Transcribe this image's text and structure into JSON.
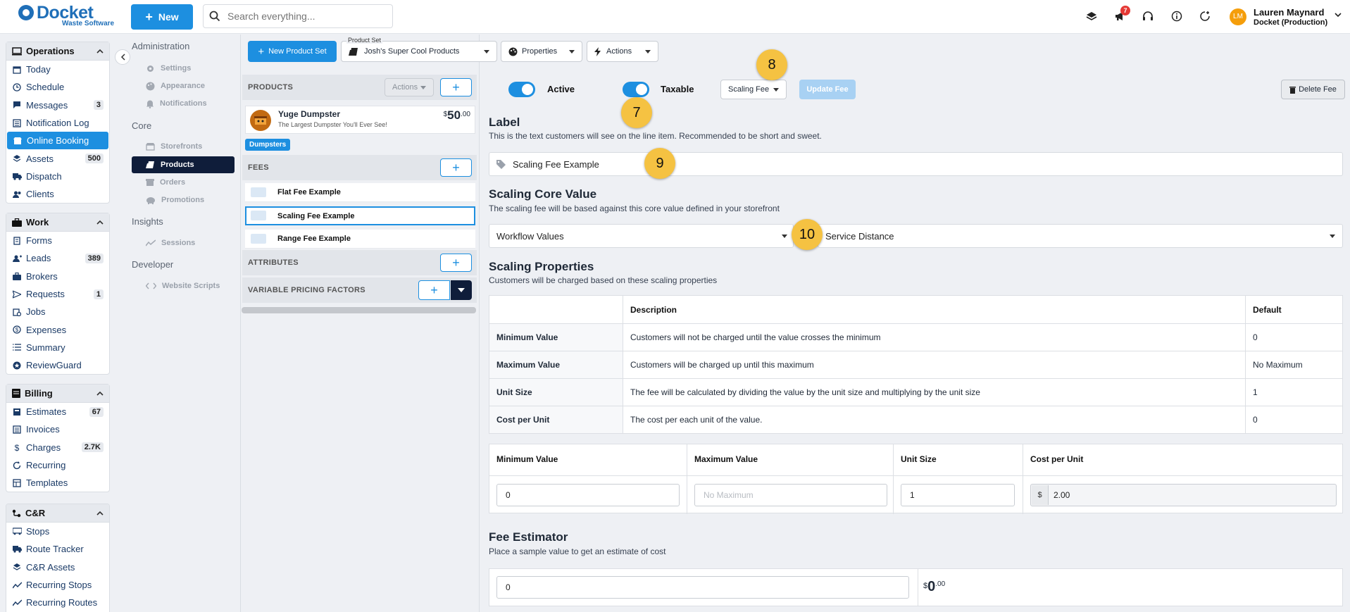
{
  "brand": {
    "name": "Docket",
    "sub": "Waste Software"
  },
  "topbar": {
    "new_label": "New",
    "search_placeholder": "Search everything...",
    "notif_count": "7",
    "user_initials": "LM",
    "user_name": "Lauren Maynard",
    "user_org": "Docket (Production)"
  },
  "sidebar": {
    "operations": {
      "title": "Operations",
      "items": [
        {
          "label": "Today"
        },
        {
          "label": "Schedule"
        },
        {
          "label": "Messages",
          "count": "3"
        },
        {
          "label": "Notification Log"
        },
        {
          "label": "Online Booking"
        },
        {
          "label": "Assets",
          "count": "500"
        },
        {
          "label": "Dispatch"
        },
        {
          "label": "Clients"
        }
      ]
    },
    "work": {
      "title": "Work",
      "items": [
        {
          "label": "Forms"
        },
        {
          "label": "Leads",
          "count": "389"
        },
        {
          "label": "Brokers"
        },
        {
          "label": "Requests",
          "count": "1"
        },
        {
          "label": "Jobs"
        },
        {
          "label": "Expenses"
        },
        {
          "label": "Summary"
        },
        {
          "label": "ReviewGuard"
        }
      ]
    },
    "billing": {
      "title": "Billing",
      "items": [
        {
          "label": "Estimates",
          "count": "67"
        },
        {
          "label": "Invoices"
        },
        {
          "label": "Charges",
          "count": "2.7K"
        },
        {
          "label": "Recurring"
        },
        {
          "label": "Templates"
        }
      ]
    },
    "cr": {
      "title": "C&R",
      "items": [
        {
          "label": "Stops"
        },
        {
          "label": "Route Tracker"
        },
        {
          "label": "C&R Assets"
        },
        {
          "label": "Recurring Stops"
        },
        {
          "label": "Recurring Routes"
        }
      ]
    }
  },
  "subnav": {
    "administration": "Administration",
    "admin_items": [
      "Settings",
      "Appearance",
      "Notifications"
    ],
    "core": "Core",
    "core_items": [
      "Storefronts",
      "Products",
      "Orders",
      "Promotions"
    ],
    "insights": "Insights",
    "insights_items": [
      "Sessions"
    ],
    "developer": "Developer",
    "developer_items": [
      "Website Scripts"
    ]
  },
  "toolbar": {
    "new_product_set": "New Product Set",
    "product_set_label": "Product Set",
    "product_set_value": "Josh's Super Cool Products",
    "properties": "Properties",
    "actions": "Actions"
  },
  "products": {
    "section": "PRODUCTS",
    "actions": "Actions",
    "item": {
      "name": "Yuge Dumpster",
      "desc": "The Largest Dumpster You'll Ever See!",
      "currency": "$",
      "price": "50",
      "cents": ".00"
    },
    "tag": "Dumpsters",
    "fees_section": "FEES",
    "fees": [
      "Flat Fee Example",
      "Scaling Fee Example",
      "Range Fee Example"
    ],
    "attributes_section": "ATTRIBUTES",
    "vpf_section": "VARIABLE PRICING FACTORS"
  },
  "fee": {
    "active_label": "Active",
    "taxable_label": "Taxable",
    "type_value": "Scaling Fee",
    "update_label": "Update Fee",
    "delete_label": "Delete Fee",
    "label_title": "Label",
    "label_desc": "This is the text customers will see on the line item. Recommended to be short and sweet.",
    "label_value": "Scaling Fee Example",
    "core_title": "Scaling Core Value",
    "core_desc": "The scaling fee will be based against this core value defined in your storefront",
    "core_group": "Workflow Values",
    "core_value": "Service Distance",
    "props_title": "Scaling Properties",
    "props_desc": "Customers will be charged based on these scaling properties",
    "table": {
      "headers": [
        "",
        "Description",
        "Default"
      ],
      "rows": [
        [
          "Minimum Value",
          "Customers will not be charged until the value crosses the minimum",
          "0"
        ],
        [
          "Maximum Value",
          "Customers will be charged up until this maximum",
          "No Maximum"
        ],
        [
          "Unit Size",
          "The fee will be calculated by dividing the value by the unit size and multiplying by the unit size",
          "1"
        ],
        [
          "Cost per Unit",
          "The cost per each unit of the value.",
          "0"
        ]
      ]
    },
    "inputs": {
      "min_label": "Minimum Value",
      "min_value": "0",
      "max_label": "Maximum Value",
      "max_placeholder": "No Maximum",
      "unit_label": "Unit Size",
      "unit_value": "1",
      "cost_label": "Cost per Unit",
      "cost_prefix": "$",
      "cost_value": "2.00"
    },
    "estimator_title": "Fee Estimator",
    "estimator_desc": "Place a sample value to get an estimate of cost",
    "estimator_input": "0",
    "estimator_currency": "$",
    "estimator_value": "0",
    "estimator_cents": ".00"
  },
  "callouts": [
    "7",
    "8",
    "9",
    "10"
  ]
}
